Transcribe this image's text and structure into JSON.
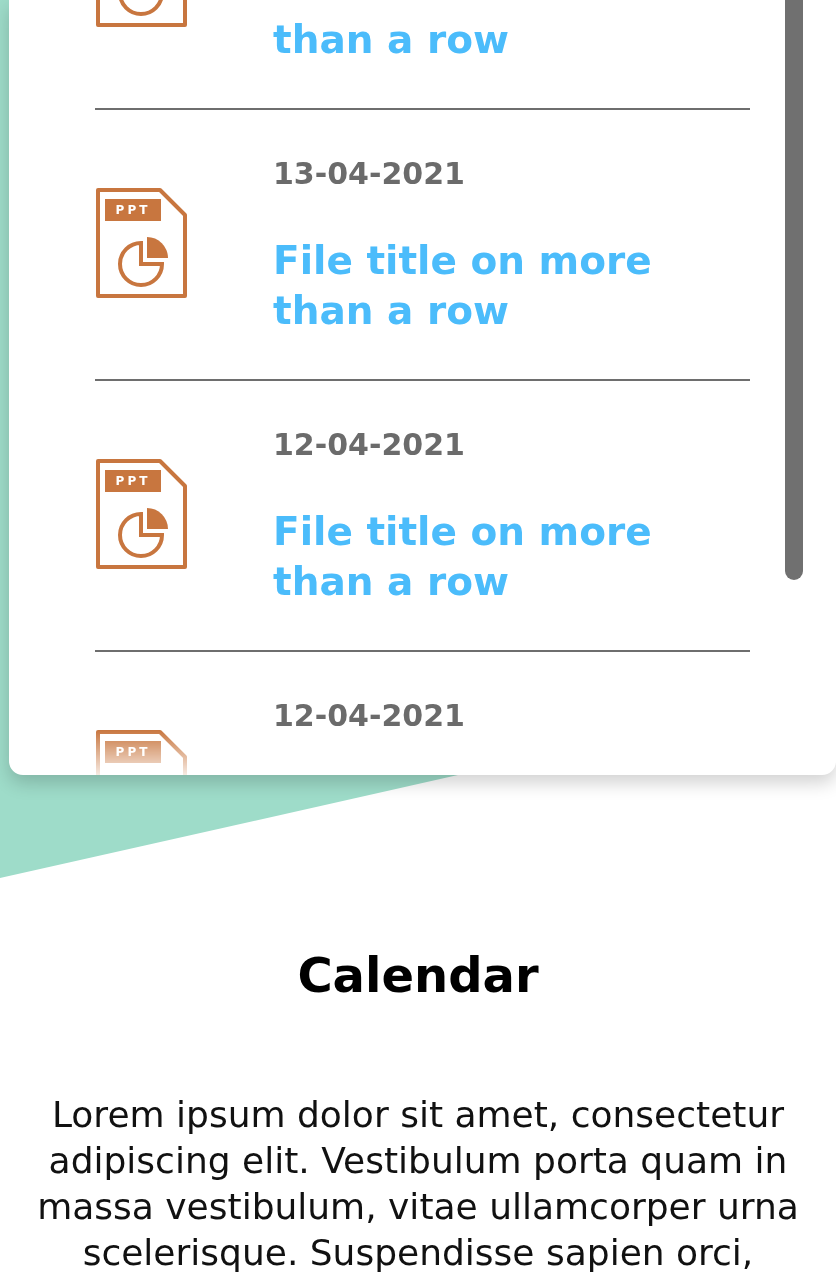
{
  "files": [
    {
      "title": "than a row"
    },
    {
      "badge": "PPT",
      "date": "13-04-2021",
      "title": "File title on more than a row"
    },
    {
      "badge": "PPT",
      "date": "12-04-2021",
      "title": "File title on more than a row"
    },
    {
      "badge": "PPT",
      "date": "12-04-2021"
    }
  ],
  "calendar": {
    "heading": "Calendar",
    "text": "Lorem ipsum dolor sit amet, consectetur adipiscing elit. Vestibulum porta quam in massa vestibulum, vitae ullamcorper urna scelerisque. Suspendisse sapien orci,"
  }
}
